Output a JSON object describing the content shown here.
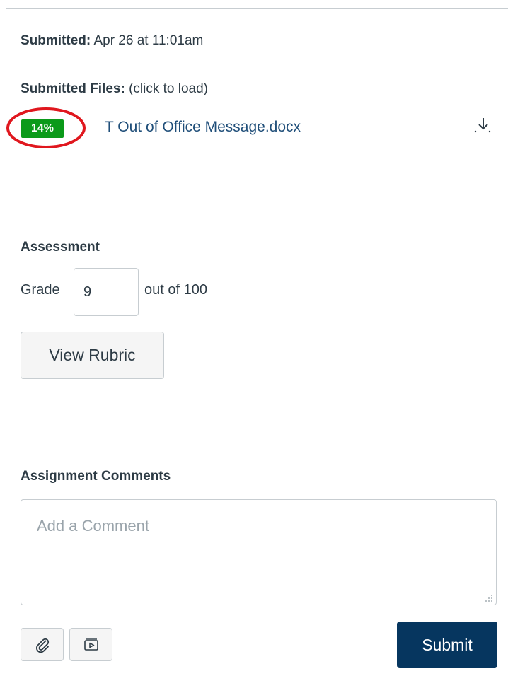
{
  "submission": {
    "submitted_label": "Submitted:",
    "submitted_value": "Apr 26 at 11:01am",
    "files_label": "Submitted Files:",
    "files_hint": "(click to load)",
    "file": {
      "score_badge": "14%",
      "name": "T Out of Office Message.docx",
      "download_icon": "download-arrow-icon"
    }
  },
  "assessment": {
    "title": "Assessment",
    "grade_label": "Grade",
    "grade_value": "9",
    "grade_suffix": "out of 100",
    "rubric_button": "View Rubric"
  },
  "comments": {
    "title": "Assignment Comments",
    "placeholder": "Add a Comment",
    "attach_icon": "paperclip-icon",
    "media_icon": "media-play-icon",
    "submit_button": "Submit"
  },
  "colors": {
    "badge_green": "#0b9a1a",
    "highlight_red": "#e0171e",
    "link_blue": "#1f4e79",
    "submit_navy": "#06365f"
  }
}
